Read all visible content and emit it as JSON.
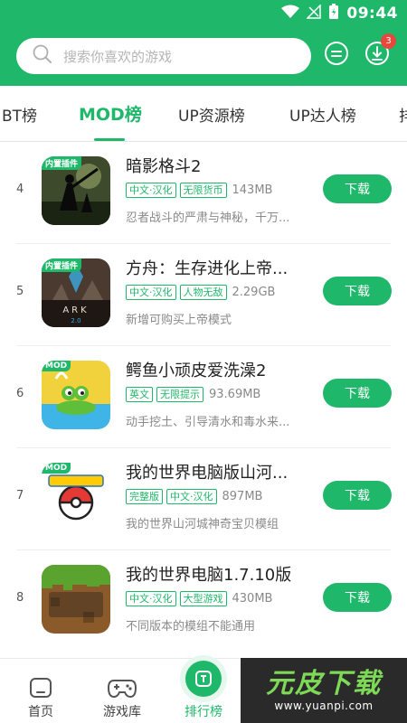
{
  "status": {
    "time": "09:44"
  },
  "search": {
    "placeholder": "搜索你喜欢的游戏"
  },
  "header": {
    "download_badge": "3"
  },
  "tabs": [
    {
      "label": "BT榜"
    },
    {
      "label": "MOD榜"
    },
    {
      "label": "UP资源榜"
    },
    {
      "label": "UP达人榜"
    },
    {
      "label": "排"
    }
  ],
  "list": [
    {
      "rank": "4",
      "name": "暗影格斗2",
      "tags": [
        "中文·汉化",
        "无限货币"
      ],
      "size": "143MB",
      "desc": "忍者战斗的严肃与神秘，千万...",
      "corner": "内置插件",
      "download_label": "下载"
    },
    {
      "rank": "5",
      "name": "方舟：生存进化上帝...",
      "tags": [
        "中文·汉化",
        "人物无敌"
      ],
      "size": "2.29GB",
      "desc": "新增可购买上帝模式",
      "corner": "内置插件",
      "download_label": "下载"
    },
    {
      "rank": "6",
      "name": "鳄鱼小顽皮爱洗澡2",
      "tags": [
        "英文",
        "无限提示"
      ],
      "size": "93.69MB",
      "desc": "动手挖土、引导清水和毒水来...",
      "corner": "MOD",
      "download_label": "下载"
    },
    {
      "rank": "7",
      "name": "我的世界电脑版山河...",
      "tags": [
        "完整版",
        "中文·汉化"
      ],
      "size": "897MB",
      "desc": "我的世界山河城神奇宝贝模组",
      "corner": "MOD",
      "download_label": "下载"
    },
    {
      "rank": "8",
      "name": "我的世界电脑1.7.10版",
      "tags": [
        "中文·汉化",
        "大型游戏"
      ],
      "size": "430MB",
      "desc": "不同版本的模组不能通用",
      "corner": "",
      "download_label": "下载"
    }
  ],
  "bottom_nav": [
    {
      "label": "首页"
    },
    {
      "label": "游戏库"
    },
    {
      "label": "排行榜"
    }
  ],
  "watermark": {
    "title": "元皮下载",
    "url": "www.yuanpi.com"
  },
  "colors": {
    "accent": "#1fb86a",
    "badge": "#e8473e"
  }
}
